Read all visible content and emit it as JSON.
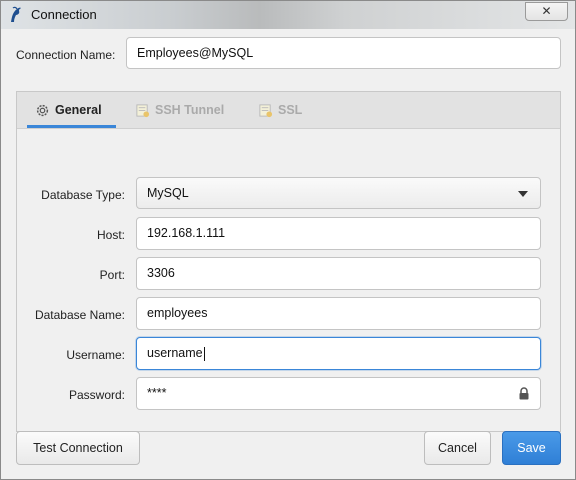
{
  "window": {
    "title": "Connection",
    "app_icon": "dolphin-icon",
    "close_glyph": "✕"
  },
  "connection_name": {
    "label": "Connection Name:",
    "value": "Employees@MySQL"
  },
  "tabs": [
    {
      "label": "General",
      "icon": "gear-icon",
      "active": true
    },
    {
      "label": "SSH Tunnel",
      "icon": "tunnel-doc-icon",
      "active": false
    },
    {
      "label": "SSL",
      "icon": "certificate-icon",
      "active": false
    }
  ],
  "form": {
    "database_type": {
      "label": "Database Type:",
      "value": "MySQL"
    },
    "host": {
      "label": "Host:",
      "value": "192.168.1.111"
    },
    "port": {
      "label": "Port:",
      "value": "3306"
    },
    "database_name": {
      "label": "Database Name:",
      "value": "employees"
    },
    "username": {
      "label": "Username:",
      "value": "username"
    },
    "password": {
      "label": "Password:",
      "value": "****",
      "icon": "lock-icon"
    }
  },
  "buttons": {
    "test": "Test Connection",
    "cancel": "Cancel",
    "save": "Save"
  },
  "colors": {
    "accent": "#3a86d8",
    "primary_button": "#2f7fd6"
  }
}
